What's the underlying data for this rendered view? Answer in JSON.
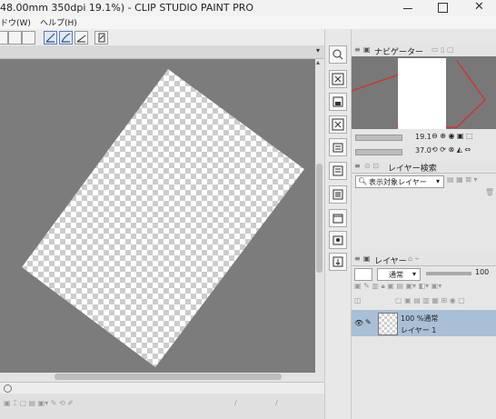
{
  "window": {
    "title": "48.00mm 350dpi 19.1%) - CLIP STUDIO PAINT PRO"
  },
  "menu": [
    "ドウ(W)",
    "ヘルプ(H)"
  ],
  "navigator": {
    "tab_label": "ナビゲーター",
    "zoom": "19.1",
    "angle": "37.0"
  },
  "layer_search": {
    "tab_label": "レイヤー検索",
    "filter_value": "表示対象レイヤー"
  },
  "layer_panel": {
    "tab_label": "レイヤー",
    "blend_mode": "通常",
    "opacity": "100",
    "layers": [
      {
        "mode_line": "100 %通常",
        "name": "レイヤー 1"
      }
    ]
  },
  "colors": {
    "canvas_bg": "#7c7c7c",
    "selected_layer": "#a9bfd6",
    "navigator_frame": "#d43030",
    "panel_bg": "#e6e6e6"
  },
  "icons": [
    "minimize-icon",
    "maximize-icon",
    "close-icon",
    "zoom-icon",
    "chevron-down-icon",
    "eye-icon",
    "pen-icon",
    "lock-icon",
    "trash-icon",
    "new-layer-icon",
    "folder-icon",
    "search-icon"
  ]
}
